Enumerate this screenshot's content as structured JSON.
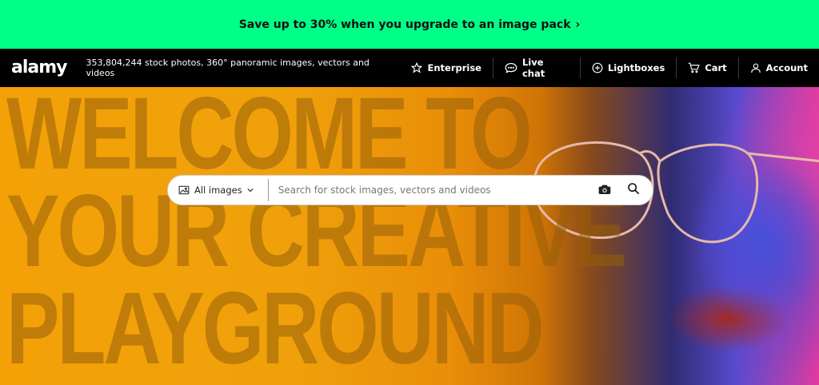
{
  "promo": {
    "text": "Save up to 30% when you upgrade to an image pack",
    "chevron": "›"
  },
  "header": {
    "logo": "alamy",
    "tagline": "353,804,244 stock photos, 360° panoramic images, vectors and videos",
    "nav": [
      {
        "label": "Enterprise",
        "icon": "star-icon"
      },
      {
        "label": "Live chat",
        "icon": "chat-icon"
      },
      {
        "label": "Lightboxes",
        "icon": "plus-circle-icon"
      },
      {
        "label": "Cart",
        "icon": "cart-icon"
      },
      {
        "label": "Account",
        "icon": "user-icon"
      }
    ]
  },
  "hero": {
    "headline_lines": [
      "WELCOME TO",
      "YOUR CREATIVE",
      "PLAYGROUND"
    ],
    "colors": {
      "orange": "#f3a107",
      "accent_green": "#00ff87",
      "bar": "#000000"
    }
  },
  "search": {
    "filter_label": "All images",
    "placeholder": "Search for stock images, vectors and videos",
    "value": ""
  }
}
